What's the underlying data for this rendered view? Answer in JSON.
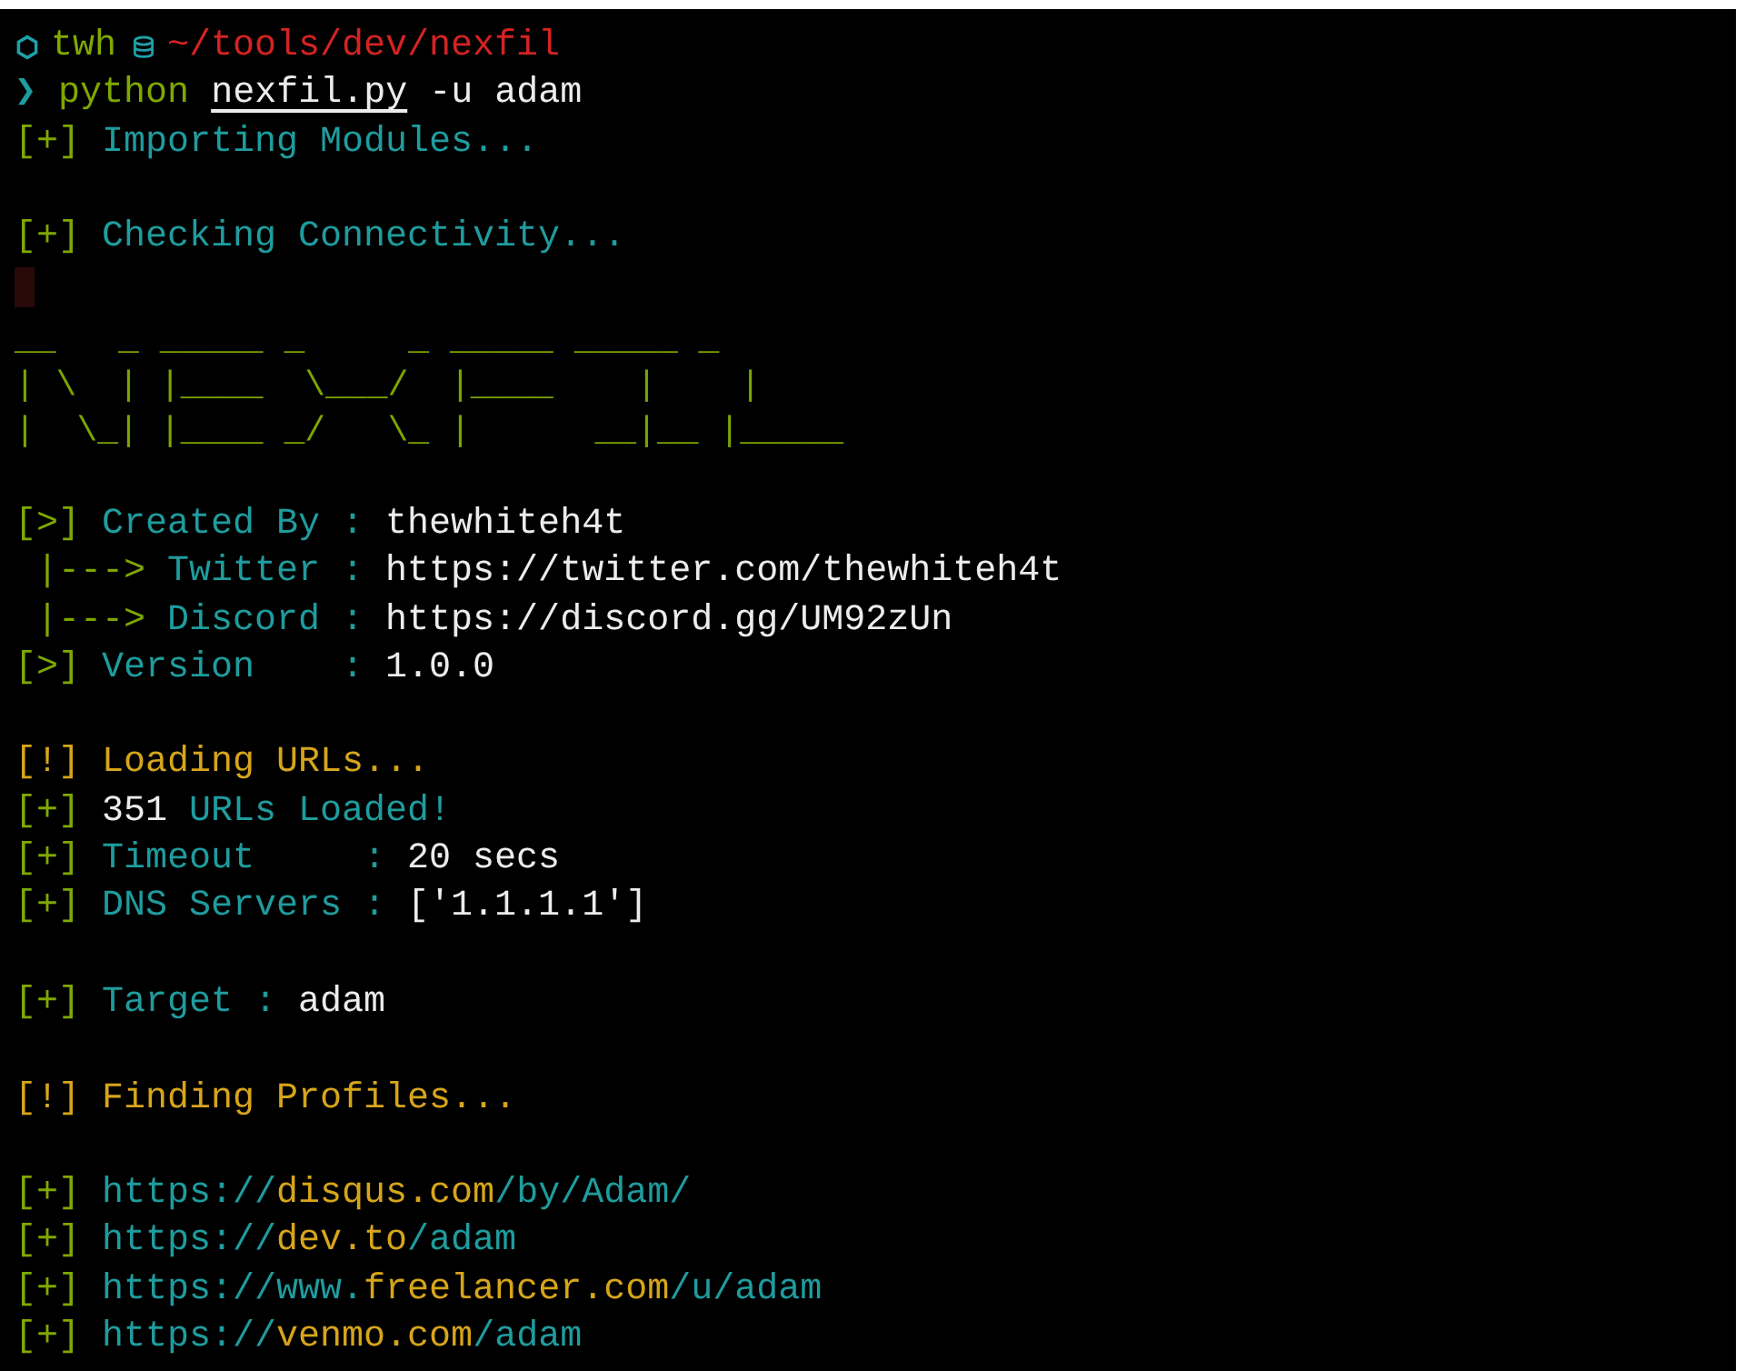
{
  "terminal": {
    "lines": [
      {
        "kind": "prompt",
        "user": "twh",
        "path": "~/tools/dev/nexfil"
      },
      {
        "kind": "command",
        "symbol": "❯",
        "program": "python",
        "script": "nexfil.py",
        "args": "-u adam"
      },
      {
        "kind": "info",
        "marker": "[+]",
        "text": "Importing Modules..."
      },
      {
        "kind": "blank"
      },
      {
        "kind": "info",
        "marker": "[+]",
        "text": "Checking Connectivity..."
      },
      {
        "kind": "cursor"
      },
      {
        "kind": "banner",
        "art": [
          "__   _ _____ _     _ _____ _____ _",
          "| \\  | |____  \\___/  |____    |    |",
          "|  \\_| |____ _/   \\_ |      __|__ |_____"
        ]
      },
      {
        "kind": "blank"
      },
      {
        "kind": "field",
        "marker": "[>]",
        "label": "Created By",
        "separator": ":",
        "value": "thewhiteh4t"
      },
      {
        "kind": "subfield",
        "marker": "|--->",
        "label": "Twitter",
        "separator": ":",
        "value": "https://twitter.com/thewhiteh4t"
      },
      {
        "kind": "subfield",
        "marker": "|--->",
        "label": "Discord",
        "separator": ":",
        "value": "https://discord.gg/UM92zUn"
      },
      {
        "kind": "field",
        "marker": "[>]",
        "label": "Version",
        "separator": ":",
        "value": "1.0.0"
      },
      {
        "kind": "blank"
      },
      {
        "kind": "warning",
        "marker": "[!]",
        "text": "Loading URLs..."
      },
      {
        "kind": "count",
        "marker": "[+]",
        "value": "351",
        "text": "URLs Loaded!"
      },
      {
        "kind": "field",
        "marker": "[+]",
        "label": "Timeout",
        "separator": ":",
        "value": "20 secs"
      },
      {
        "kind": "field",
        "marker": "[+]",
        "label": "DNS Servers",
        "separator": ":",
        "value": "['1.1.1.1']"
      },
      {
        "kind": "blank"
      },
      {
        "kind": "field",
        "marker": "[+]",
        "label": "Target",
        "separator": ":",
        "value": "adam"
      },
      {
        "kind": "blank"
      },
      {
        "kind": "warning",
        "marker": "[!]",
        "text": "Finding Profiles..."
      },
      {
        "kind": "blank"
      },
      {
        "kind": "url",
        "marker": "[+]",
        "pre": "https://",
        "host": "disqus.com",
        "post": "/by/Adam/"
      },
      {
        "kind": "url",
        "marker": "[+]",
        "pre": "https://",
        "host": "dev.to",
        "post": "/adam"
      },
      {
        "kind": "url",
        "marker": "[+]",
        "pre": "https://www.",
        "host": "freelancer.com",
        "post": "/u/adam"
      },
      {
        "kind": "url",
        "marker": "[+]",
        "pre": "https://",
        "host": "venmo.com",
        "post": "/adam"
      }
    ]
  }
}
